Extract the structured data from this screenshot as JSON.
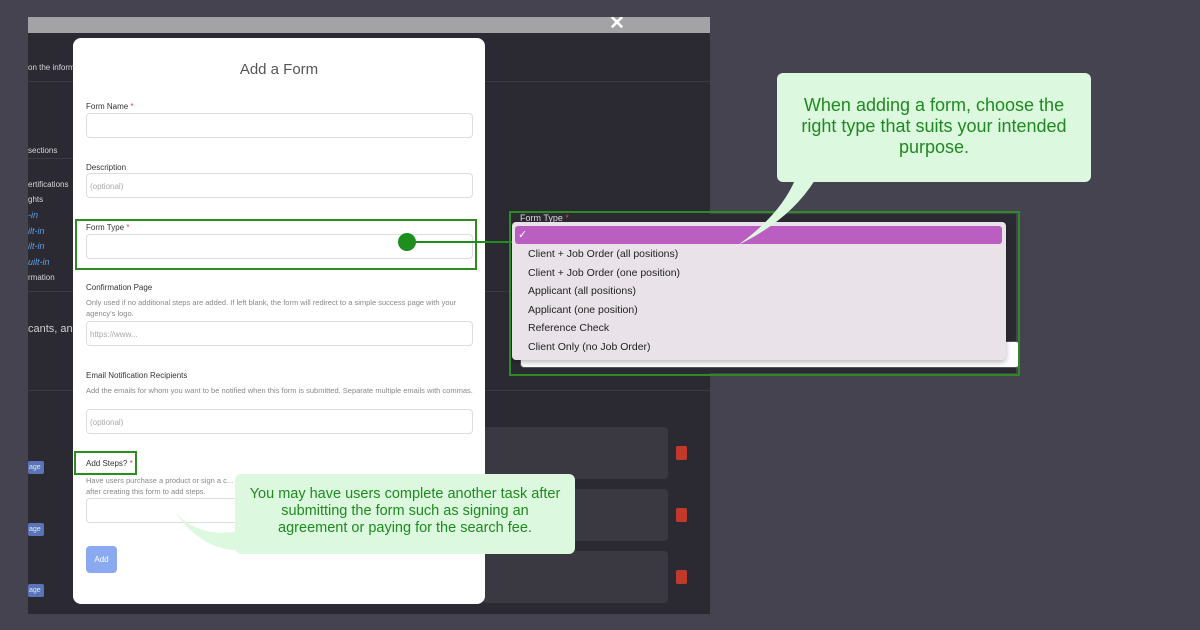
{
  "background": {
    "close_glyph": "✕",
    "header_fragment": "on the informa",
    "sections_fragment": "sections",
    "sidebar_fragments": [
      "ertifications",
      "ghts",
      "-in",
      "ilt-in",
      "ilt-in",
      "uilt-in",
      "rmation"
    ],
    "body_fragment": "cants, and",
    "pill_label": "age"
  },
  "modal": {
    "title": "Add a Form",
    "form_name_label": "Form Name",
    "description_label": "Description",
    "description_placeholder": "(optional)",
    "form_type_label": "Form Type",
    "confirmation_label": "Confirmation Page",
    "confirmation_help": "Only used if no additional steps are added. If left blank, the form will redirect to a simple success page with your agency's logo.",
    "confirmation_placeholder": "https://www...",
    "email_label": "Email Notification Recipients",
    "email_help": "Add the emails for whom you want to be notified when this form is submitted. Separate multiple emails with commas.",
    "email_placeholder": "(optional)",
    "steps_label": "Add Steps?",
    "steps_help": "Have users purchase a product or sign a c... after creating this form to add steps.",
    "add_button": "Add",
    "required_mark": "*"
  },
  "dropdown": {
    "label": "Form Type",
    "selected_mark": "✓",
    "options": [
      "Client + Job Order (all positions)",
      "Client + Job Order (one position)",
      "Applicant (all positions)",
      "Applicant (one position)",
      "Reference Check",
      "Client Only (no Job Order)"
    ]
  },
  "callouts": {
    "form_type_tip": "When adding a form, choose the right type that suits your intended purpose.",
    "steps_tip": "You may have users complete another task after submitting the form such as signing an agreement or paying for the search fee."
  },
  "colors": {
    "highlight_green": "#2e8b22",
    "callout_bg": "#dcf8df",
    "callout_text": "#1f8a1f",
    "selected_option": "#bb5ec2",
    "add_button": "#8aa9f1",
    "required": "#e0464c"
  }
}
